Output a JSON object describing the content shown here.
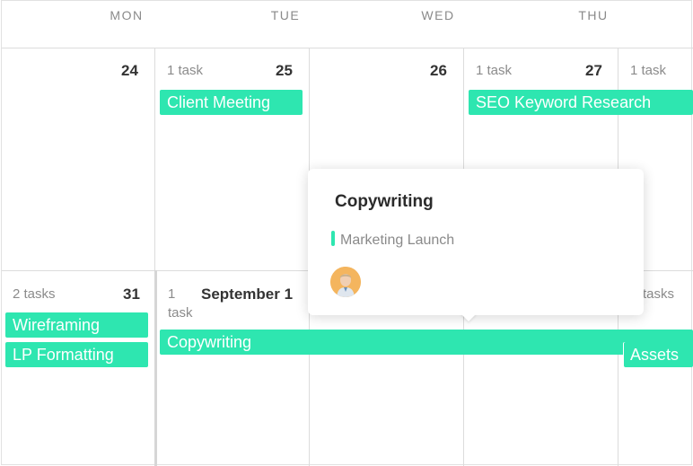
{
  "weekdays": [
    "MON",
    "TUE",
    "WED",
    "THU"
  ],
  "week1": {
    "mon": {
      "day": "24"
    },
    "tue": {
      "day": "25",
      "count": "1 task"
    },
    "wed": {
      "day": "26"
    },
    "thu": {
      "day": "27",
      "count": "1 task"
    },
    "fri": {
      "count": "1 task"
    }
  },
  "week2": {
    "mon": {
      "day": "31",
      "count": "2 tasks"
    },
    "tue": {
      "day": "September 1",
      "count_num": "1",
      "count_word": "task"
    },
    "fri": {
      "count": "tasks"
    }
  },
  "events": {
    "client_meeting": "Client Meeting",
    "seo": "SEO Keyword Research",
    "wireframing": "Wireframing",
    "lp_formatting": "LP Formatting",
    "copywriting": "Copywriting",
    "assets": "Assets"
  },
  "popup": {
    "title": "Copywriting",
    "project": "Marketing Launch",
    "avatar": "user-avatar"
  },
  "colors": {
    "accent": "#2ee6b0",
    "grid": "#dcdcdc",
    "muted_text": "#8b8b8b"
  }
}
